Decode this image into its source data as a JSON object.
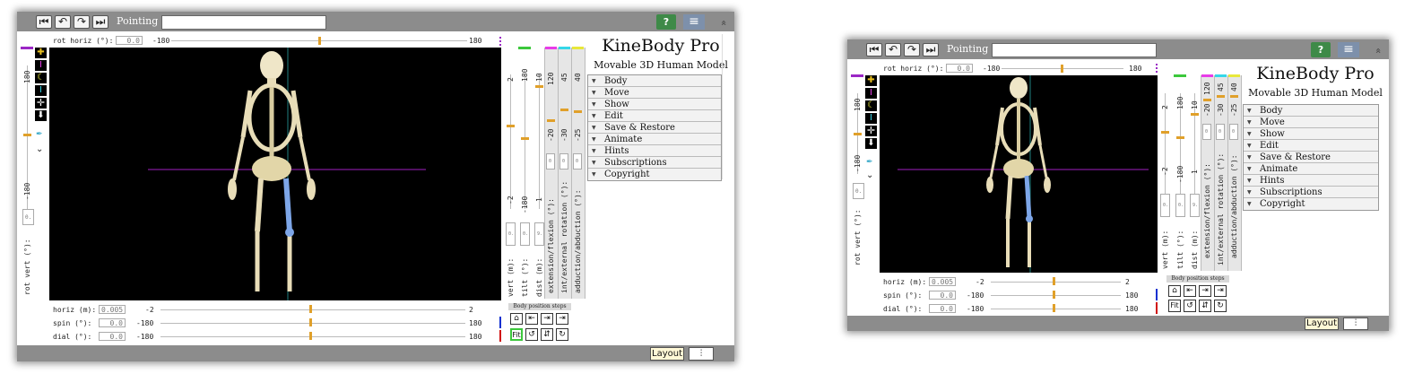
{
  "toolbar": {
    "pointing_label": "Pointing at:",
    "pointing_value": "",
    "help_label": "?",
    "menu_label": "≡",
    "collapse_label": "«"
  },
  "app": {
    "title": "KineBody Pro",
    "subtitle": "Movable 3D Human Model"
  },
  "menu_items": [
    "Body",
    "Move",
    "Show",
    "Edit",
    "Save & Restore",
    "Animate",
    "Hints",
    "Subscriptions",
    "Copyright"
  ],
  "camera": {
    "rot_horiz": {
      "label": "rot horiz (°):",
      "value": "0.0",
      "min": "-180",
      "max": "180",
      "fraction": 0.5
    },
    "rot_vert": {
      "label": "rot vert (°):",
      "value": "0.0",
      "min": "-180",
      "max": "180",
      "fraction": 0.5
    },
    "horiz": {
      "label": "horiz (m):",
      "value": "0.005",
      "min": "-2",
      "max": "2",
      "fraction": 0.5
    },
    "spin": {
      "label": "spin  (°):",
      "value": "0.0",
      "min": "-180",
      "max": "180",
      "fraction": 0.5
    },
    "dial": {
      "label": "dial  (°):",
      "value": "0.0",
      "min": "-180",
      "max": "180",
      "fraction": 0.5
    },
    "vert": {
      "label": "vert  (m):",
      "value": "0.465",
      "min": "-2",
      "max": "2",
      "fraction": 0.62
    },
    "tilt": {
      "label": "tilt  (°):",
      "value": "0.0",
      "min": "-180",
      "max": "180",
      "fraction": 0.5
    },
    "dist": {
      "label": "dist  (m):",
      "value": "9.427",
      "min": "1",
      "max": "10",
      "fraction": 0.82
    }
  },
  "joint_controls": [
    {
      "label": "extension/flexion (°):",
      "value": "0.0",
      "min": "-20",
      "max": "120",
      "fraction": 0.45,
      "color": "#e83ce8"
    },
    {
      "label": "int/external rotation (°):",
      "value": "0.0",
      "min": "-30",
      "max": "45",
      "fraction": 0.48,
      "color": "#35d7e8"
    },
    {
      "label": "adduction/abduction (°):",
      "value": "0.0",
      "min": "-25",
      "max": "40",
      "fraction": 0.46,
      "color": "#e8e83a"
    }
  ],
  "steps": {
    "label": "Body position steps",
    "fit_label": "Fit"
  },
  "bottom": {
    "layout_label": "Layout",
    "adjust_label": "⫶"
  },
  "colors": {
    "accent_orange": "#e0a02a",
    "help_green": "#3e8a48",
    "menu_blue": "#7d90ab",
    "bar_gray": "#8c8c8c",
    "purple": "#9b27c5",
    "green": "#3cc83c",
    "blue": "#1030d0",
    "red": "#d01010"
  }
}
